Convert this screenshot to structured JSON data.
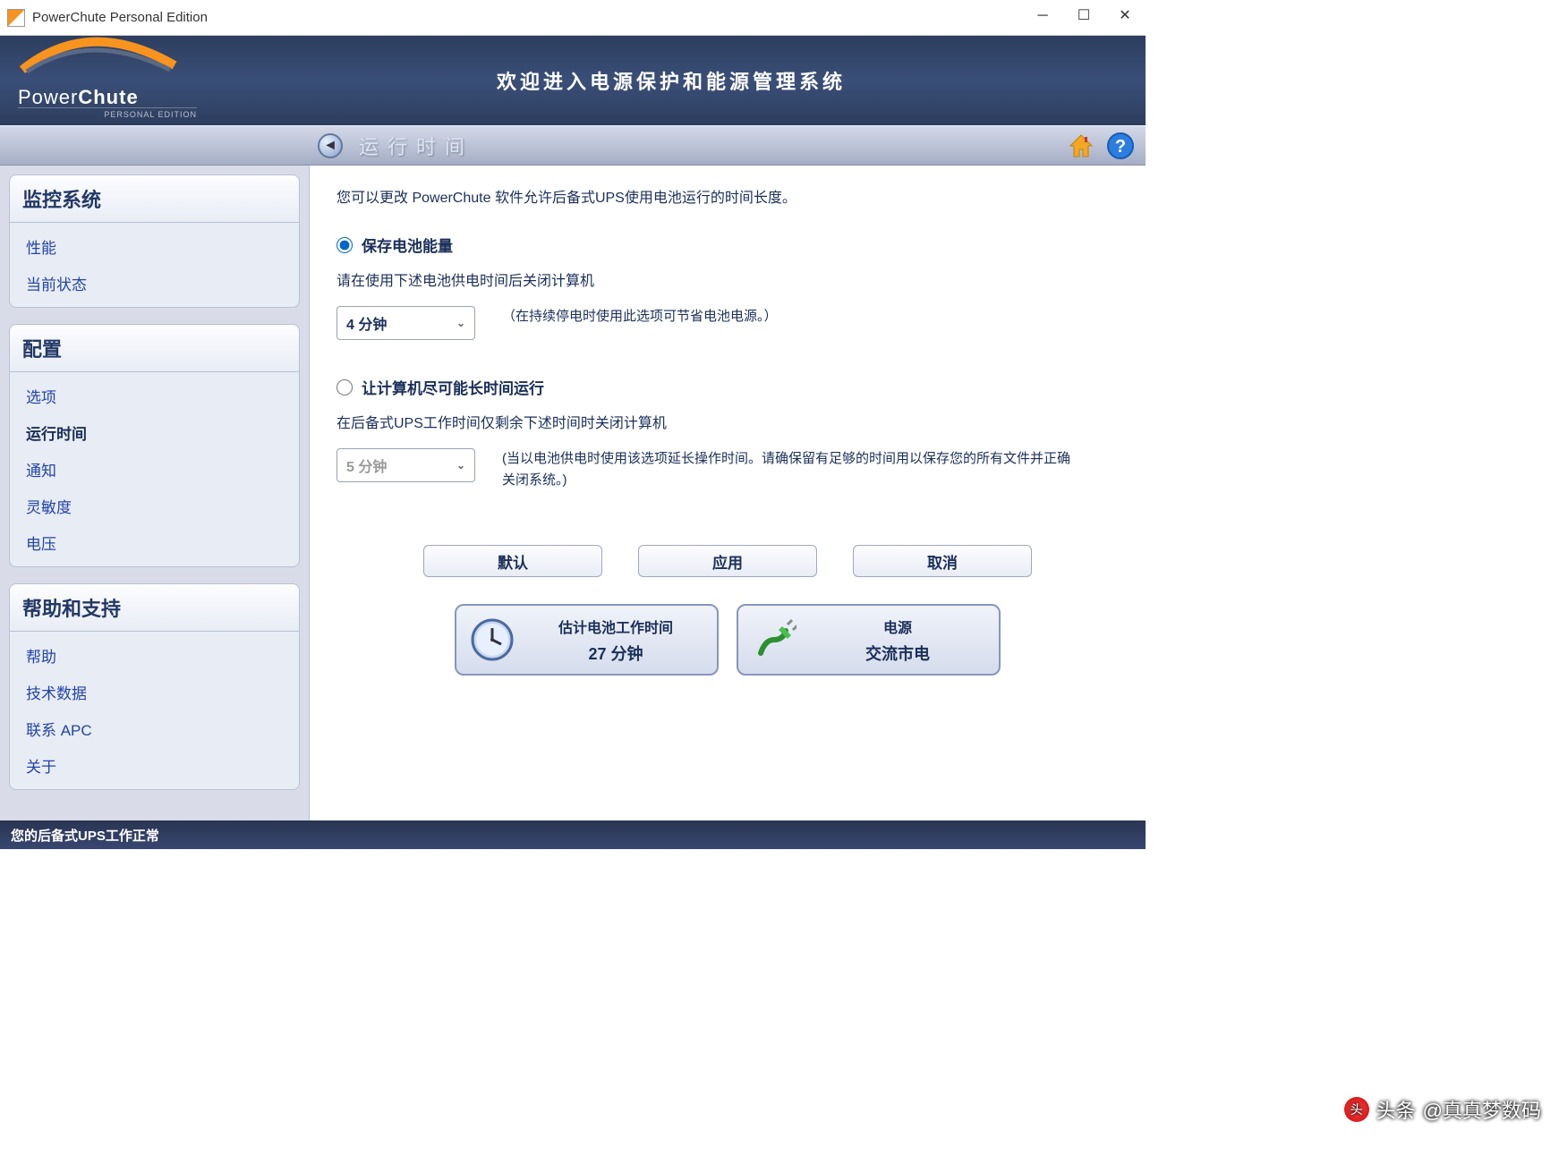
{
  "titlebar": {
    "title": "PowerChute Personal Edition"
  },
  "banner": {
    "logo_main": "Power",
    "logo_main2": "Chute",
    "logo_sub": "PERSONAL EDITION",
    "welcome": "欢迎进入电源保护和能源管理系统"
  },
  "toolbar": {
    "page_title": "运行时间"
  },
  "sidebar": {
    "groups": [
      {
        "header": "监控系统",
        "items": [
          "性能",
          "当前状态"
        ]
      },
      {
        "header": "配置",
        "items": [
          "选项",
          "运行时间",
          "通知",
          "灵敏度",
          "电压"
        ]
      },
      {
        "header": "帮助和支持",
        "items": [
          "帮助",
          "技术数据",
          "联系 APC",
          "关于"
        ]
      }
    ],
    "active": "运行时间"
  },
  "main": {
    "intro": "您可以更改 PowerChute 软件允许后备式UPS使用电池运行的时间长度。",
    "option1": {
      "label": "保存电池能量",
      "desc": "请在使用下述电池供电时间后关闭计算机",
      "select_value": "4 分钟",
      "hint": "（在持续停电时使用此选项可节省电池电源。）",
      "checked": true
    },
    "option2": {
      "label": "让计算机尽可能长时间运行",
      "desc": "在后备式UPS工作时间仅剩余下述时间时关闭计算机",
      "select_value": "5 分钟",
      "hint": "(当以电池供电时使用该选项延长操作时间。请确保留有足够的时间用以保存您的所有文件并正确关闭系统。)",
      "checked": false
    },
    "buttons": {
      "default": "默认",
      "apply": "应用",
      "cancel": "取消"
    },
    "status": {
      "runtime_label": "估计电池工作时间",
      "runtime_value": "27 分钟",
      "power_label": "电源",
      "power_value": "交流市电"
    }
  },
  "footer": {
    "status": "您的后备式UPS工作正常"
  },
  "watermark": {
    "prefix": "头条",
    "text": "@真真梦数码"
  }
}
